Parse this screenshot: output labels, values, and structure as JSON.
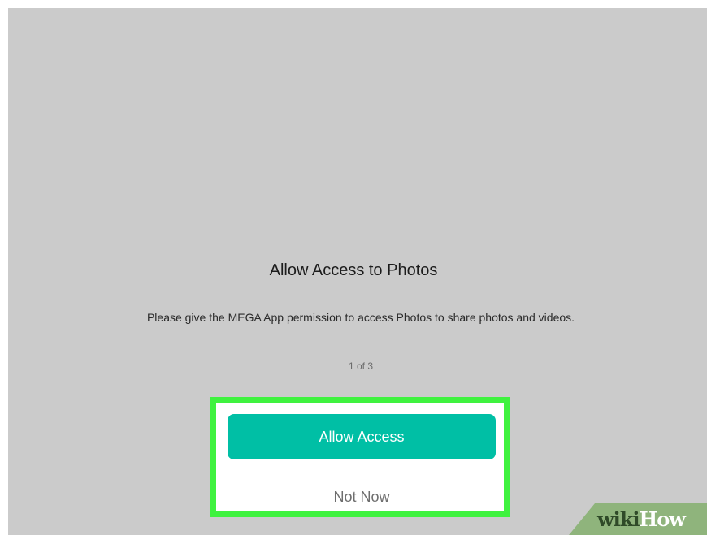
{
  "dialog": {
    "title": "Allow Access to Photos",
    "message": "Please give the MEGA App permission to access Photos to share photos and videos.",
    "pager": "1 of 3",
    "allow_label": "Allow Access",
    "not_now_label": "Not Now"
  },
  "watermark": {
    "wiki": "wiki",
    "how": "How"
  },
  "colors": {
    "background": "#cbcbcb",
    "accent": "#00bfa5",
    "highlight": "#3ff23f"
  }
}
